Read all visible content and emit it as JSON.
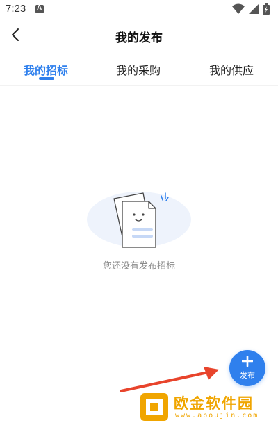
{
  "status_bar": {
    "time": "7:23",
    "icons": [
      "a-icon",
      "wifi-icon",
      "signal-icon",
      "battery-icon"
    ]
  },
  "nav": {
    "title": "我的发布",
    "back_icon": "chevron-left-icon"
  },
  "tabs": [
    {
      "label": "我的招标",
      "active": true
    },
    {
      "label": "我的采购",
      "active": false
    },
    {
      "label": "我的供应",
      "active": false
    }
  ],
  "empty_state": {
    "illustration": "empty-document-illustration",
    "message": "您还没有发布招标"
  },
  "fab": {
    "icon": "plus-icon",
    "label": "发布"
  },
  "watermark": {
    "title": "欧金软件园",
    "url": "www.apoujin.com"
  },
  "colors": {
    "accent": "#2f80ed",
    "text": "#222222",
    "muted": "#8a8a8a",
    "arrow": "#e8442c",
    "watermark": "#f0a500"
  }
}
